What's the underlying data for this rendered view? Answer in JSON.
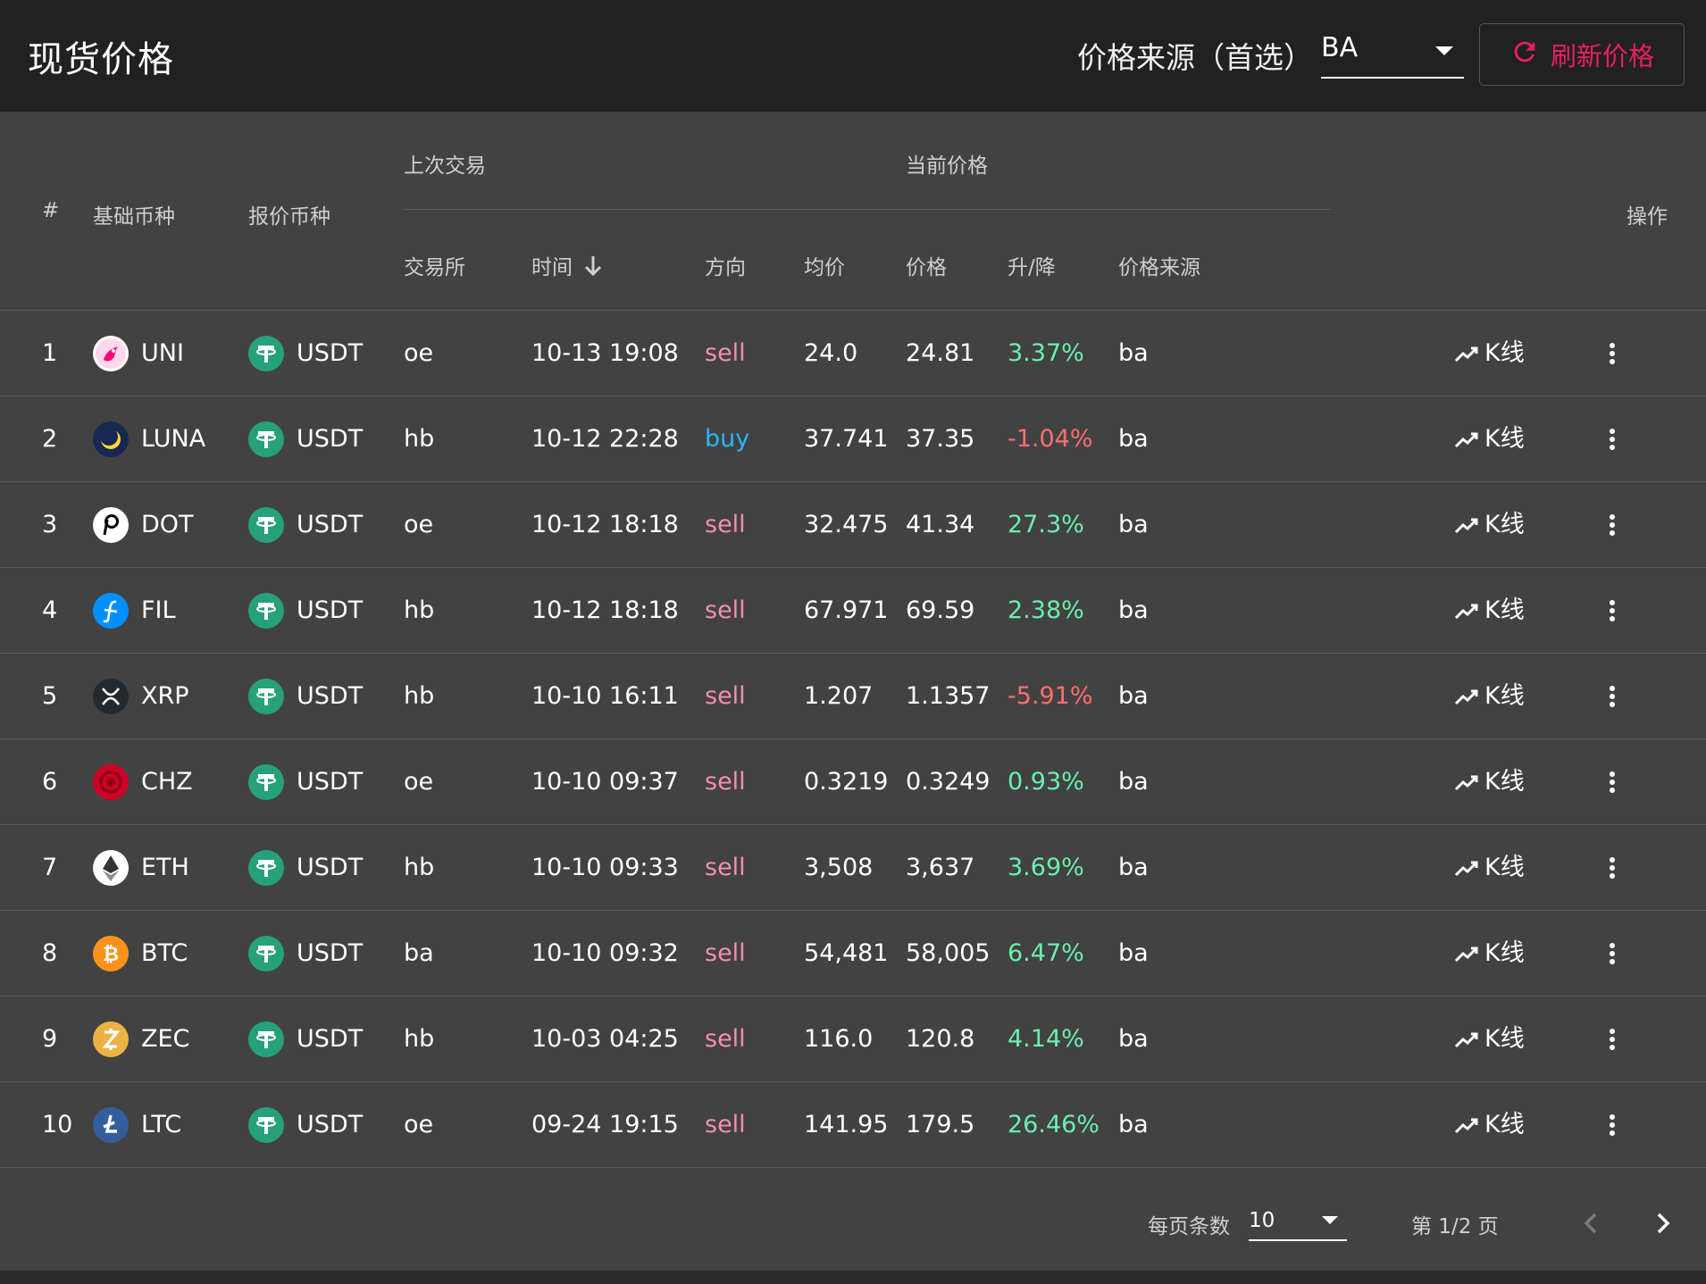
{
  "header": {
    "title": "现货价格",
    "source_label": "价格来源（首选）",
    "source_value": "BA",
    "refresh_label": "刷新价格"
  },
  "table": {
    "headers": {
      "index": "#",
      "base": "基础币种",
      "quote": "报价币种",
      "last_trade_group": "上次交易",
      "current_price_group": "当前价格",
      "exchange": "交易所",
      "time": "时间",
      "direction": "方向",
      "avg_price": "均价",
      "price": "价格",
      "change": "升/降",
      "price_source": "价格来源",
      "actions": "操作"
    },
    "kline_label": "K线",
    "rows": [
      {
        "idx": "1",
        "base": "UNI",
        "quote": "USDT",
        "exchange": "oe",
        "time": "10-13 19:08",
        "direction": "sell",
        "avg": "24.0",
        "price": "24.81",
        "change": "3.37%",
        "trend": "up",
        "source": "ba"
      },
      {
        "idx": "2",
        "base": "LUNA",
        "quote": "USDT",
        "exchange": "hb",
        "time": "10-12 22:28",
        "direction": "buy",
        "avg": "37.741",
        "price": "37.35",
        "change": "-1.04%",
        "trend": "down",
        "source": "ba"
      },
      {
        "idx": "3",
        "base": "DOT",
        "quote": "USDT",
        "exchange": "oe",
        "time": "10-12 18:18",
        "direction": "sell",
        "avg": "32.475",
        "price": "41.34",
        "change": "27.3%",
        "trend": "up",
        "source": "ba"
      },
      {
        "idx": "4",
        "base": "FIL",
        "quote": "USDT",
        "exchange": "hb",
        "time": "10-12 18:18",
        "direction": "sell",
        "avg": "67.971",
        "price": "69.59",
        "change": "2.38%",
        "trend": "up",
        "source": "ba"
      },
      {
        "idx": "5",
        "base": "XRP",
        "quote": "USDT",
        "exchange": "hb",
        "time": "10-10 16:11",
        "direction": "sell",
        "avg": "1.207",
        "price": "1.1357",
        "change": "-5.91%",
        "trend": "down",
        "source": "ba"
      },
      {
        "idx": "6",
        "base": "CHZ",
        "quote": "USDT",
        "exchange": "oe",
        "time": "10-10 09:37",
        "direction": "sell",
        "avg": "0.3219",
        "price": "0.3249",
        "change": "0.93%",
        "trend": "up",
        "source": "ba"
      },
      {
        "idx": "7",
        "base": "ETH",
        "quote": "USDT",
        "exchange": "hb",
        "time": "10-10 09:33",
        "direction": "sell",
        "avg": "3,508",
        "price": "3,637",
        "change": "3.69%",
        "trend": "up",
        "source": "ba"
      },
      {
        "idx": "8",
        "base": "BTC",
        "quote": "USDT",
        "exchange": "ba",
        "time": "10-10 09:32",
        "direction": "sell",
        "avg": "54,481",
        "price": "58,005",
        "change": "6.47%",
        "trend": "up",
        "source": "ba"
      },
      {
        "idx": "9",
        "base": "ZEC",
        "quote": "USDT",
        "exchange": "hb",
        "time": "10-03 04:25",
        "direction": "sell",
        "avg": "116.0",
        "price": "120.8",
        "change": "4.14%",
        "trend": "up",
        "source": "ba"
      },
      {
        "idx": "10",
        "base": "LTC",
        "quote": "USDT",
        "exchange": "oe",
        "time": "09-24 19:15",
        "direction": "sell",
        "avg": "141.95",
        "price": "179.5",
        "change": "26.46%",
        "trend": "up",
        "source": "ba"
      }
    ]
  },
  "pagination": {
    "per_page_label": "每页条数",
    "per_page_value": "10",
    "page_info": "第 1/2 页"
  },
  "colors": {
    "sell": "#f48fb1",
    "buy": "#29b6f6",
    "up": "#69f0ae",
    "down": "#ff6e6e",
    "accent": "#e91e63"
  }
}
